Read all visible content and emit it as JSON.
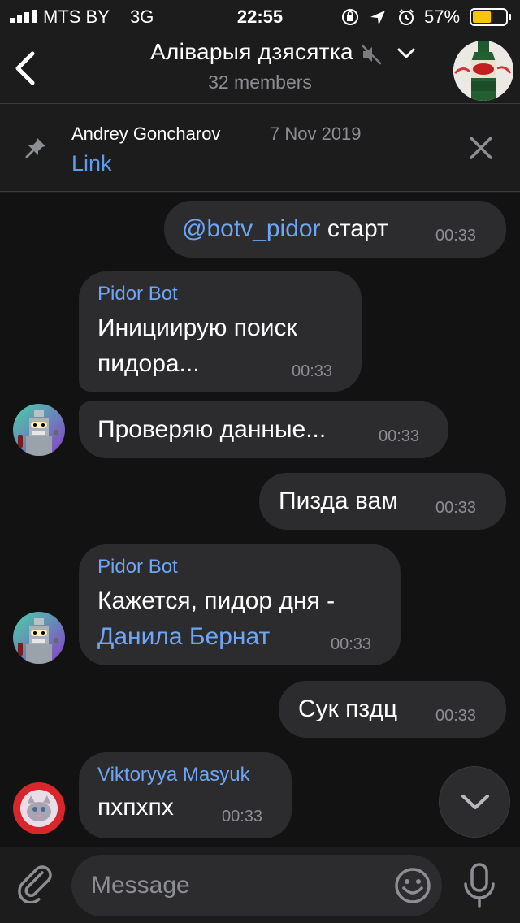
{
  "status_bar": {
    "carrier": "MTS BY",
    "network": "3G",
    "time": "22:55",
    "battery_percent": "57%",
    "battery_level": 0.57
  },
  "header": {
    "title": "Аліварыя дзясятка",
    "subtitle": "32 members",
    "icons": [
      "back-icon",
      "mute-icon",
      "chevron-down-icon",
      "group-avatar"
    ]
  },
  "pinned": {
    "author": "Andrey Goncharov",
    "date": "7 Nov 2019",
    "text": "Link"
  },
  "messages": [
    {
      "direction": "out",
      "mention": "@botv_pidor",
      "text": "старт",
      "time": "00:33"
    },
    {
      "direction": "in",
      "sender": "Pidor Bot",
      "lines": [
        "Инициирую поиск",
        "пидора..."
      ],
      "time": "00:33"
    },
    {
      "direction": "in",
      "text": "Проверяю данные...",
      "time": "00:33"
    },
    {
      "direction": "out",
      "text": "Пизда вам",
      "time": "00:33"
    },
    {
      "direction": "in",
      "sender": "Pidor Bot",
      "text": "Кажется, пидор дня -",
      "link": "Данила Бернат",
      "time": "00:33"
    },
    {
      "direction": "out",
      "text": "Сук пздц",
      "time": "00:33"
    },
    {
      "direction": "in",
      "sender": "Viktoryya Masyuk",
      "text": "пхпхпх",
      "time": "00:33"
    }
  ],
  "input": {
    "placeholder": "Message"
  },
  "colors": {
    "background": "#121212",
    "bar": "#1c1c1d",
    "bubble": "#2c2c2e",
    "accent": "#6ea6f5",
    "secondary_text": "#8d8e93",
    "battery": "#f7c600"
  }
}
